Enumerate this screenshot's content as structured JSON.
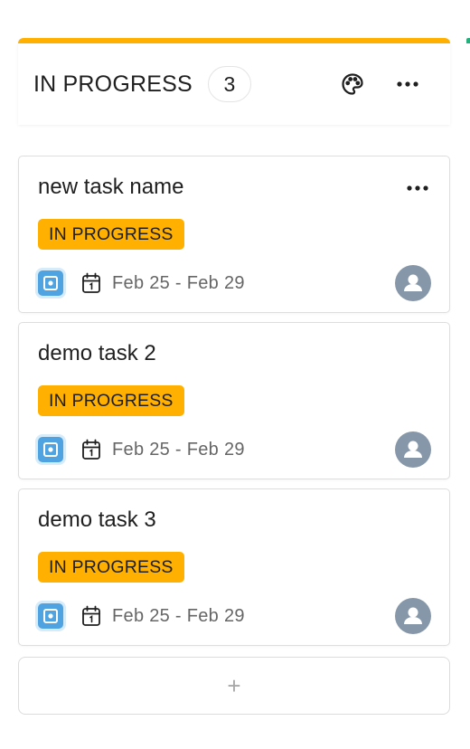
{
  "column": {
    "title": "IN PROGRESS",
    "count": "3",
    "accent_color": "#ffb000",
    "icons": [
      "palette-icon",
      "more-horizontal-icon"
    ]
  },
  "cards": [
    {
      "title": "new task name",
      "status": "IN PROGRESS",
      "date_range": "Feb 25 - Feb 29",
      "type_icon": "task-type-icon",
      "assignee_icon": "user-avatar-icon",
      "has_menu": true
    },
    {
      "title": "demo task 2",
      "status": "IN PROGRESS",
      "date_range": "Feb 25 - Feb 29",
      "type_icon": "task-type-icon",
      "assignee_icon": "user-avatar-icon",
      "has_menu": false
    },
    {
      "title": "demo task 3",
      "status": "IN PROGRESS",
      "date_range": "Feb 25 - Feb 29",
      "type_icon": "task-type-icon",
      "assignee_icon": "user-avatar-icon",
      "has_menu": false
    }
  ],
  "add_card": {
    "label": "+"
  },
  "colors": {
    "status_tag": "#ffb000",
    "type_icon": "#4fa3e0",
    "avatar": "#8797aa",
    "next_column_accent": "#23b07d"
  }
}
